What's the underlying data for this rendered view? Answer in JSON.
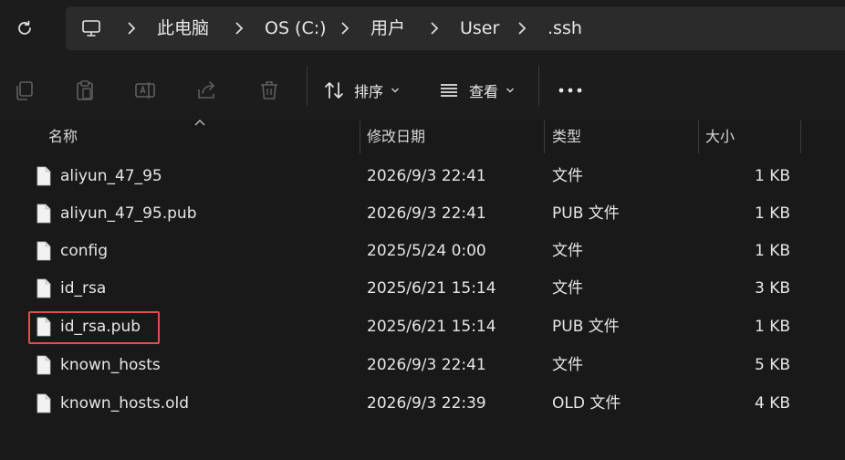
{
  "address_bar": {
    "crumbs": [
      "此电脑",
      "OS (C:)",
      "用户",
      "User",
      ".ssh"
    ]
  },
  "toolbar": {
    "sort_label": "排序",
    "view_label": "查看"
  },
  "columns": {
    "name": "名称",
    "modified": "修改日期",
    "type": "类型",
    "size": "大小"
  },
  "files": [
    {
      "name": "aliyun_47_95",
      "modified": "2026/9/3 22:41",
      "type": "文件",
      "size": "1 KB"
    },
    {
      "name": "aliyun_47_95.pub",
      "modified": "2026/9/3 22:41",
      "type": "PUB 文件",
      "size": "1 KB"
    },
    {
      "name": "config",
      "modified": "2025/5/24 0:00",
      "type": "文件",
      "size": "1 KB"
    },
    {
      "name": "id_rsa",
      "modified": "2025/6/21 15:14",
      "type": "文件",
      "size": "3 KB"
    },
    {
      "name": "id_rsa.pub",
      "modified": "2025/6/21 15:14",
      "type": "PUB 文件",
      "size": "1 KB"
    },
    {
      "name": "known_hosts",
      "modified": "2026/9/3 22:41",
      "type": "文件",
      "size": "5 KB"
    },
    {
      "name": "known_hosts.old",
      "modified": "2026/9/3 22:39",
      "type": "OLD 文件",
      "size": "4 KB"
    }
  ],
  "highlighted_file": "id_rsa.pub",
  "icons": {
    "refresh": "refresh-icon",
    "computer": "computer-icon",
    "copy": "copy-icon",
    "paste": "paste-icon",
    "rename": "rename-icon",
    "share": "share-icon",
    "delete": "trash-icon",
    "sort": "sort-icon",
    "view": "view-icon",
    "more": "more-icon",
    "file": "file-icon"
  },
  "colors": {
    "highlight": "#e0504a",
    "background": "#191919"
  }
}
